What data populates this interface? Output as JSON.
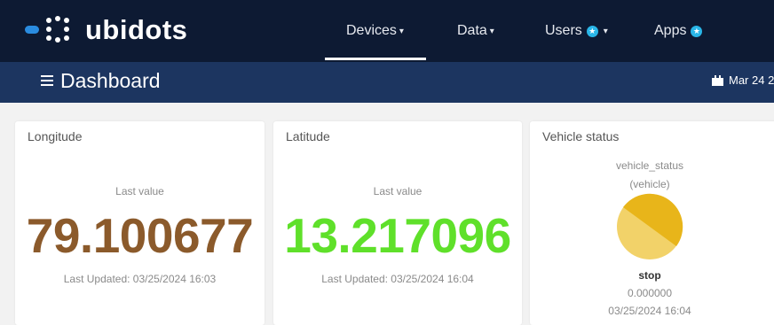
{
  "brand": {
    "name": "ubidots"
  },
  "nav": [
    {
      "label": "Devices",
      "caret": "▾"
    },
    {
      "label": "Data",
      "caret": "▾"
    },
    {
      "label": "Users",
      "caret": "▾",
      "badge": "★"
    },
    {
      "label": "Apps",
      "badge": "★"
    }
  ],
  "subheader": {
    "title": "Dashboard",
    "date": "Mar 24 2"
  },
  "widgets": {
    "longitude": {
      "title": "Longitude",
      "label": "Last value",
      "value": "79.100677",
      "updated": "Last Updated: 03/25/2024 16:03",
      "color": "#8b5a2b"
    },
    "latitude": {
      "title": "Latitude",
      "label": "Last value",
      "value": "13.217096",
      "updated": "Last Updated: 03/25/2024 16:04",
      "color": "#5fe02a"
    },
    "vehicle_status": {
      "title": "Vehicle status",
      "variable": "vehicle_status",
      "device": "(vehicle)",
      "state": "stop",
      "value": "0.000000",
      "timestamp": "03/25/2024 16:04",
      "colors": {
        "dark": "#e8b51a",
        "light": "#f2d269"
      }
    }
  },
  "colors": {
    "topbar": "#0d1a33",
    "subbar": "#1c3560",
    "badge": "#29b6e8"
  }
}
